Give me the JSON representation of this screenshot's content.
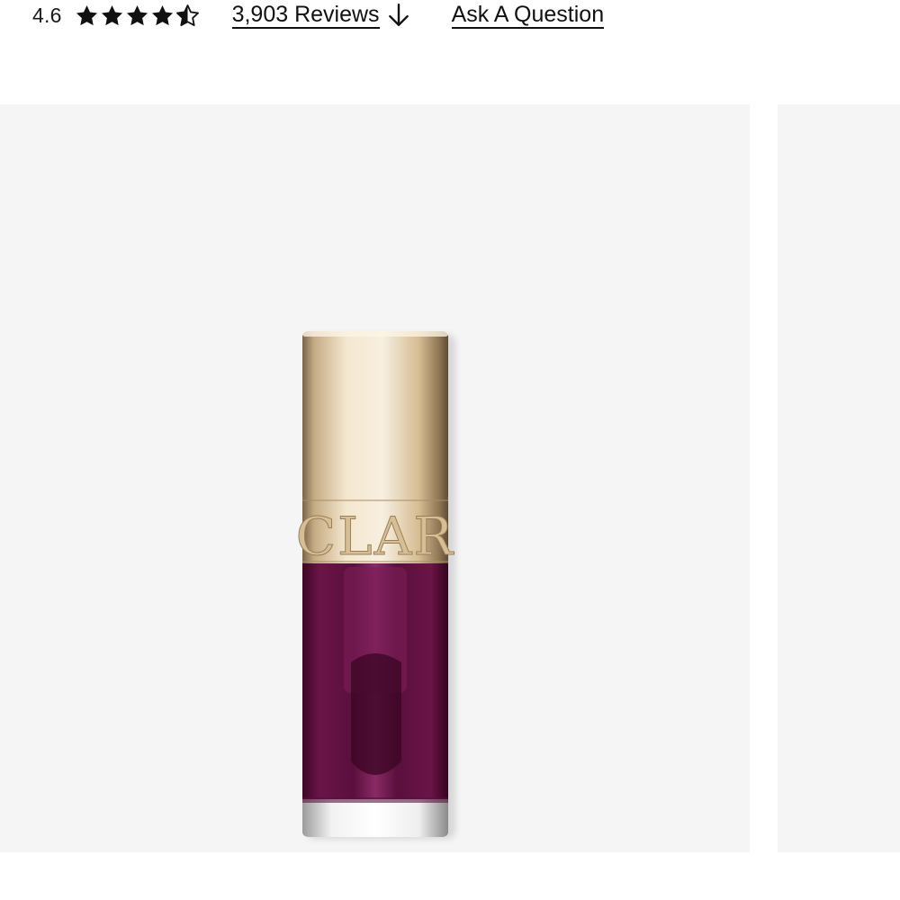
{
  "rating": {
    "value": "4.6",
    "stars_filled": 4.5,
    "stars_total": 5,
    "reviews_link": "3,903 Reviews",
    "ask_link": "Ask A Question"
  },
  "gallery": {
    "image_alt": "Clarins lip comfort oil in plum with gold cap",
    "cap_lettering": "CLAR",
    "colors": {
      "background": "#f5f5f5",
      "gold": "#d9c29a",
      "plum": "#5a0f3d"
    }
  },
  "icons": {
    "star": "star-icon",
    "half_star": "star-half-icon",
    "arrow": "arrow-down-icon"
  }
}
